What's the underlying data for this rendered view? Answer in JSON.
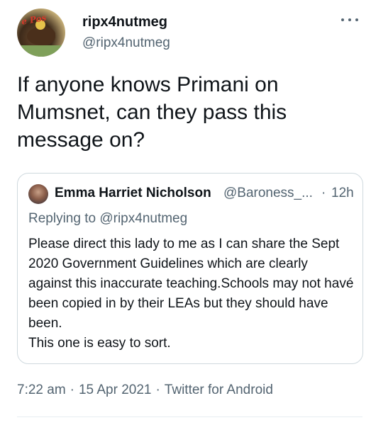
{
  "author": {
    "display_name": "ripx4nutmeg",
    "username": "@ripx4nutmeg",
    "avatar_stamp": "e Pos"
  },
  "tweet": {
    "text": "If anyone knows Primani on Mumsnet, can they pass this message on?"
  },
  "quoted": {
    "name": "Emma Harriet Nicholson",
    "handle": "@Baroness_...",
    "separator": "·",
    "time": "12h",
    "replying_prefix": "Replying to",
    "replying_handle": "@ripx4nutmeg",
    "text": "Please direct this lady to me as I can share the Sept 2020 Government Guidelines which are clearly against this inaccurate teaching.Schools may not havé been copied in by their LEAs but they should have been.\nThis one is easy to sort."
  },
  "meta": {
    "time": "7:22 am",
    "date": "15 Apr 2021",
    "source": "Twitter for Android",
    "separator": "·"
  },
  "colors": {
    "text": "#0f1419",
    "secondary": "#536471",
    "border": "#cfd9de"
  }
}
